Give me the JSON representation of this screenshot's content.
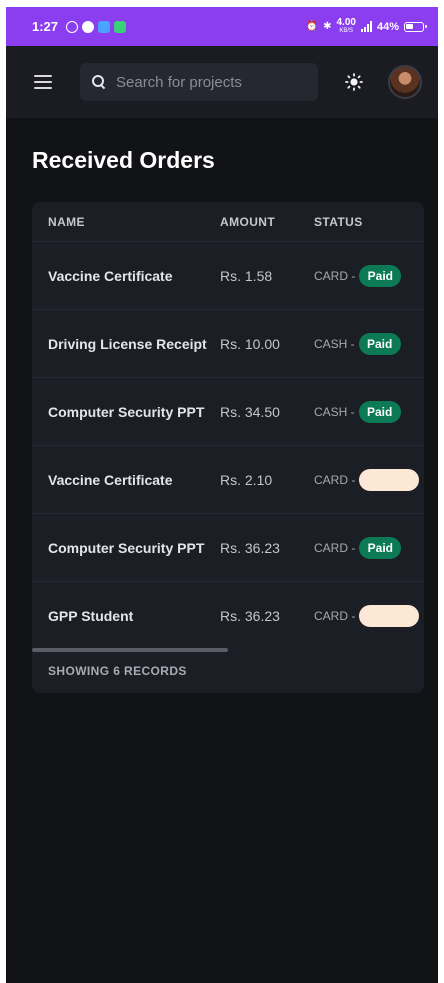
{
  "status_bar": {
    "time": "1:27",
    "rate_value": "4.00",
    "rate_unit": "KB/S",
    "battery": "44%"
  },
  "header": {
    "search_placeholder": "Search for projects"
  },
  "page": {
    "title": "Received Orders"
  },
  "table": {
    "columns": {
      "name": "NAME",
      "amount": "AMOUNT",
      "status": "STATUS"
    },
    "rows": [
      {
        "name": "Vaccine Certificate",
        "amount": "Rs. 1.58",
        "method": "CARD -",
        "status": "Paid"
      },
      {
        "name": "Driving License Receipt",
        "amount": "Rs. 10.00",
        "method": "CASH -",
        "status": "Paid"
      },
      {
        "name": "Computer Security PPT",
        "amount": "Rs. 34.50",
        "method": "CASH -",
        "status": "Paid"
      },
      {
        "name": "Vaccine Certificate",
        "amount": "Rs. 2.10",
        "method": "CARD -",
        "status": ""
      },
      {
        "name": "Computer Security PPT",
        "amount": "Rs. 36.23",
        "method": "CARD -",
        "status": "Paid"
      },
      {
        "name": "GPP Student",
        "amount": "Rs. 36.23",
        "method": "CARD -",
        "status": ""
      }
    ],
    "footer": "SHOWING 6 RECORDS"
  },
  "colors": {
    "status_bar": "#8b3df0",
    "background": "#121317",
    "card": "#1c1e25",
    "paid_badge": "#0b7a55",
    "pending_badge": "#fde8d6"
  }
}
